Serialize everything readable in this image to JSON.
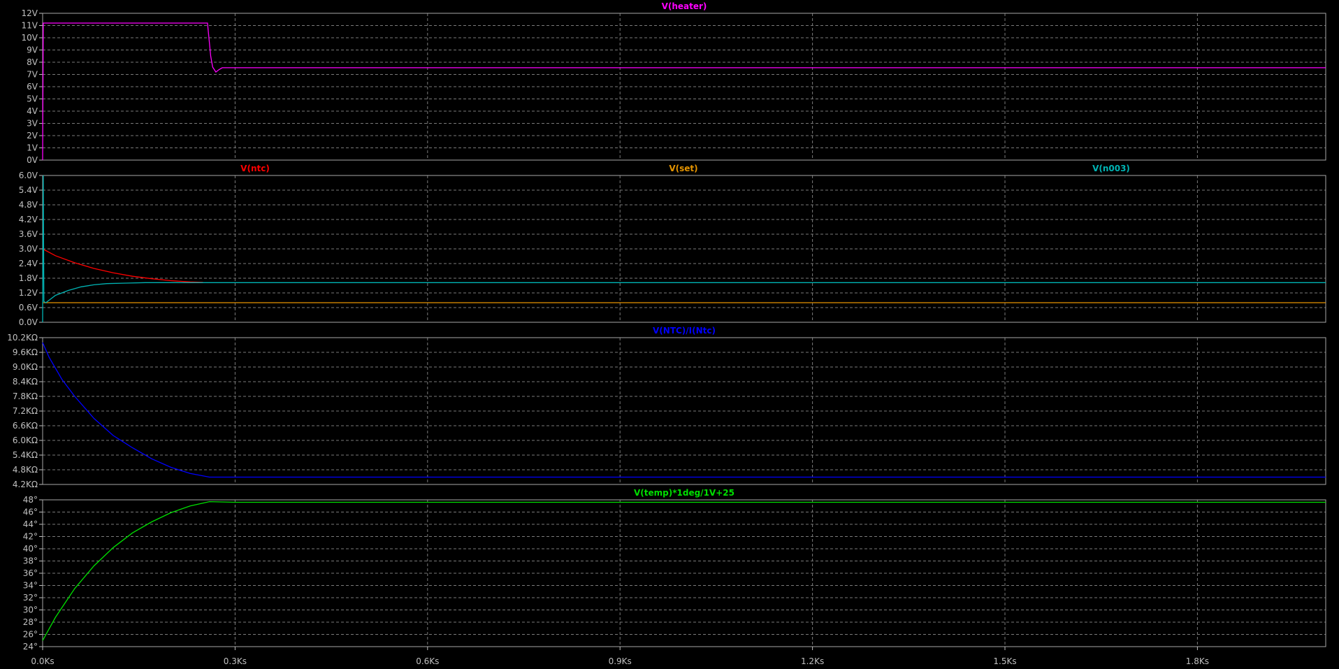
{
  "window": {
    "background": "#000000",
    "grid_color": "#7a7a7a",
    "border_color": "#a8a8a8",
    "tick_color": "#c0c0c0"
  },
  "x_axis": {
    "ticks": [
      0,
      0.3,
      0.6,
      0.9,
      1.2,
      1.5,
      1.8
    ],
    "tick_labels": [
      "0.0Ks",
      "0.3Ks",
      "0.6Ks",
      "0.9Ks",
      "1.2Ks",
      "1.5Ks",
      "1.8Ks"
    ],
    "range": [
      0,
      2.0
    ],
    "unit": "Ks"
  },
  "chart_data": [
    {
      "type": "line",
      "pane": "heater",
      "ylim": [
        0,
        12
      ],
      "yticks": [
        0,
        1,
        2,
        3,
        4,
        5,
        6,
        7,
        8,
        9,
        10,
        11,
        12
      ],
      "ytick_labels": [
        "0V",
        "1V",
        "2V",
        "3V",
        "4V",
        "5V",
        "6V",
        "7V",
        "8V",
        "9V",
        "10V",
        "11V",
        "12V"
      ],
      "grid": true,
      "series": [
        {
          "name": "V(heater)",
          "color": "#ff00ff",
          "x": [
            0,
            0.001,
            0.257,
            0.262,
            0.265,
            0.27,
            0.275,
            0.28,
            0.29,
            2.0
          ],
          "y": [
            0,
            11.2,
            11.2,
            8.5,
            7.6,
            7.2,
            7.4,
            7.55,
            7.55,
            7.55
          ]
        }
      ]
    },
    {
      "type": "line",
      "pane": "voltages",
      "ylim": [
        0,
        6
      ],
      "yticks": [
        0,
        0.6,
        1.2,
        1.8,
        2.4,
        3.0,
        3.6,
        4.2,
        4.8,
        5.4,
        6.0
      ],
      "ytick_labels": [
        "0.0V",
        "0.6V",
        "1.2V",
        "1.8V",
        "2.4V",
        "3.0V",
        "3.6V",
        "4.2V",
        "4.8V",
        "5.4V",
        "6.0V"
      ],
      "grid": true,
      "series": [
        {
          "name": "V(ntc)",
          "color": "#ff0000",
          "x": [
            0,
            0.02,
            0.05,
            0.08,
            0.11,
            0.14,
            0.17,
            0.2,
            0.23,
            0.25
          ],
          "y": [
            3.0,
            2.72,
            2.43,
            2.2,
            2.02,
            1.88,
            1.78,
            1.7,
            1.65,
            1.63
          ]
        },
        {
          "name": "V(set)",
          "color": "#e59400",
          "x": [
            0,
            2.0
          ],
          "y": [
            0.8,
            0.8
          ]
        },
        {
          "name": "V(n003)",
          "color": "#00b4b4",
          "x": [
            0,
            0.001,
            0.002,
            0.005,
            0.02,
            0.04,
            0.06,
            0.08,
            0.1,
            0.13,
            0.16,
            0.2,
            2.0
          ],
          "y": [
            0,
            6.0,
            0.85,
            0.8,
            1.1,
            1.3,
            1.45,
            1.53,
            1.58,
            1.6,
            1.62,
            1.62,
            1.62
          ]
        }
      ]
    },
    {
      "type": "line",
      "pane": "resistance",
      "ylim": [
        4.2,
        10.2
      ],
      "yticks": [
        4.2,
        4.8,
        5.4,
        6.0,
        6.6,
        7.2,
        7.8,
        8.4,
        9.0,
        9.6,
        10.2
      ],
      "ytick_labels": [
        "4.2KΩ",
        "4.8KΩ",
        "5.4KΩ",
        "6.0KΩ",
        "6.6KΩ",
        "7.2KΩ",
        "7.8KΩ",
        "8.4KΩ",
        "9.0KΩ",
        "9.6KΩ",
        "10.2KΩ"
      ],
      "grid": true,
      "series": [
        {
          "name": "V(NTC)/I(Ntc)",
          "color": "#0000ff",
          "x": [
            0,
            0.01,
            0.03,
            0.05,
            0.08,
            0.11,
            0.14,
            0.17,
            0.2,
            0.23,
            0.26,
            2.0
          ],
          "y": [
            10.0,
            9.4,
            8.5,
            7.8,
            6.9,
            6.2,
            5.7,
            5.25,
            4.9,
            4.65,
            4.5,
            4.5
          ]
        }
      ]
    },
    {
      "type": "line",
      "pane": "temperature",
      "ylim": [
        24,
        48
      ],
      "yticks": [
        24,
        26,
        28,
        30,
        32,
        34,
        36,
        38,
        40,
        42,
        44,
        46,
        48
      ],
      "ytick_labels": [
        "24°",
        "26°",
        "28°",
        "30°",
        "32°",
        "34°",
        "36°",
        "38°",
        "40°",
        "42°",
        "44°",
        "46°",
        "48°"
      ],
      "grid": true,
      "series": [
        {
          "name": "V(temp)*1deg/1V+25",
          "color": "#00e000",
          "x": [
            0,
            0.02,
            0.05,
            0.08,
            0.11,
            0.14,
            0.17,
            0.2,
            0.23,
            0.26,
            0.3,
            2.0
          ],
          "y": [
            25.0,
            28.8,
            33.5,
            37.2,
            40.2,
            42.6,
            44.4,
            45.9,
            47.0,
            47.7,
            47.6,
            47.6
          ]
        }
      ]
    }
  ]
}
